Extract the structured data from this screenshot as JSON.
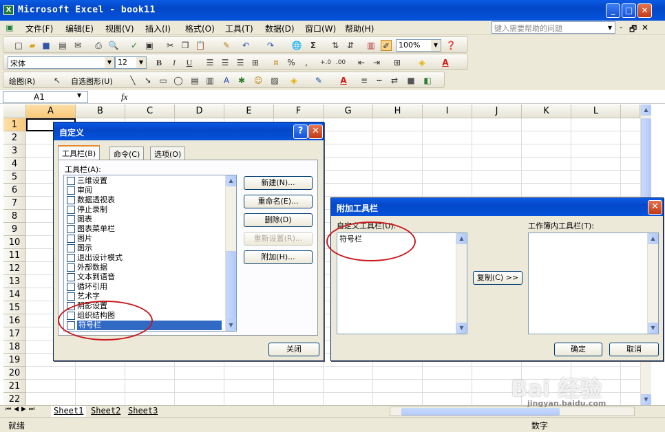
{
  "app": {
    "title": "Microsoft Excel - book11",
    "excel_icon": "X"
  },
  "window_controls": {
    "minimize": "_",
    "maximize": "□",
    "close": "✕"
  },
  "menu": {
    "items": [
      "文件(F)",
      "编辑(E)",
      "视图(V)",
      "插入(I)",
      "格式(O)",
      "工具(T)",
      "数据(D)",
      "窗口(W)",
      "帮助(H)"
    ],
    "help_placeholder": "键入需要帮助的问题",
    "doc_controls": [
      "▾",
      "-",
      "🗗",
      "✕"
    ]
  },
  "toolbar": {
    "zoom": "100%",
    "font_name": "宋体",
    "font_size": "12",
    "bold": "B",
    "italic": "I",
    "underline": "U",
    "percent": "%",
    "comma": ",",
    "sigma": "Σ"
  },
  "drawing_toolbar": {
    "draw_label": "绘图(R)",
    "autoshape_label": "自选图形(U)"
  },
  "formula_bar": {
    "name_box": "A1",
    "fx": "fx"
  },
  "sheet": {
    "columns": [
      "A",
      "B",
      "C",
      "D",
      "E",
      "F",
      "G",
      "H",
      "I",
      "J",
      "K",
      "L"
    ],
    "rows": [
      "1",
      "2",
      "3",
      "4",
      "5",
      "6",
      "7",
      "8",
      "9",
      "10",
      "11",
      "12",
      "13",
      "14",
      "15",
      "16",
      "17",
      "18",
      "19",
      "20",
      "21",
      "22"
    ],
    "tabs": [
      "Sheet1",
      "Sheet2",
      "Sheet3"
    ]
  },
  "customize_dialog": {
    "title": "自定义",
    "help_btn": "?",
    "close_x": "✕",
    "tabs": [
      "工具栏(B)",
      "命令(C)",
      "选项(O)"
    ],
    "list_label": "工具栏(A):",
    "items": [
      "三维设置",
      "审阅",
      "数据透视表",
      "停止录制",
      "图表",
      "图表菜单栏",
      "图片",
      "图示",
      "退出设计模式",
      "外部数据",
      "文本到语音",
      "循环引用",
      "艺术字",
      "阴影设置",
      "组织结构图",
      "符号栏"
    ],
    "selected_index": 15,
    "buttons": {
      "new": "新建(N)...",
      "rename": "重命名(E)...",
      "delete": "删除(D)",
      "reset": "重新设置(R)...",
      "attach": "附加(H)..."
    },
    "close_button": "关闭"
  },
  "attach_dialog": {
    "title": "附加工具栏",
    "close_x": "✕",
    "custom_label": "自定义工具栏(U):",
    "custom_items": [
      "符号栏"
    ],
    "workbook_label": "工作簿内工具栏(T):",
    "copy_button": "复制(C) >>",
    "ok_button": "确定",
    "cancel_button": "取消"
  },
  "status": {
    "ready": "就绪",
    "mode": "数字"
  },
  "watermark": {
    "brand": "Bai 经验",
    "url": "jingyan.baidu.com"
  },
  "colors": {
    "xp_blue": "#0553db",
    "selection": "#316ac5",
    "annotation_red": "#c8191e"
  }
}
